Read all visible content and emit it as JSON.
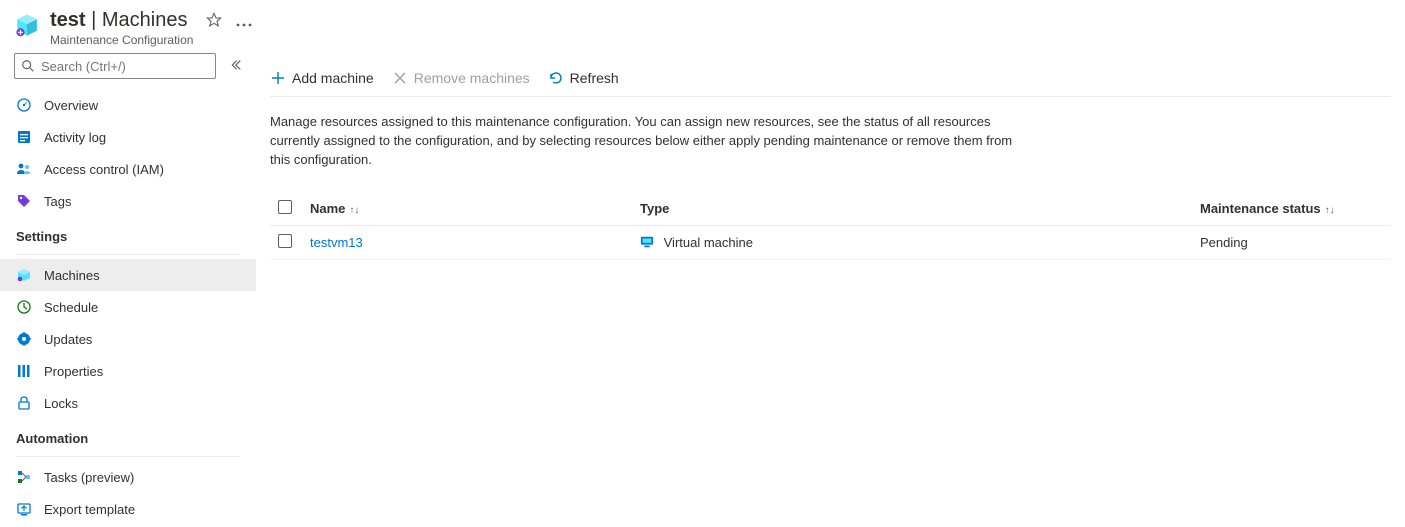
{
  "header": {
    "title_prefix": "test",
    "title_separator": " | ",
    "title_suffix": "Machines",
    "subtitle": "Maintenance Configuration"
  },
  "sidebar": {
    "search_placeholder": "Search (Ctrl+/)",
    "items_top": [
      {
        "label": "Overview"
      },
      {
        "label": "Activity log"
      },
      {
        "label": "Access control (IAM)"
      },
      {
        "label": "Tags"
      }
    ],
    "section_settings": "Settings",
    "items_settings": [
      {
        "label": "Machines"
      },
      {
        "label": "Schedule"
      },
      {
        "label": "Updates"
      },
      {
        "label": "Properties"
      },
      {
        "label": "Locks"
      }
    ],
    "section_automation": "Automation",
    "items_automation": [
      {
        "label": "Tasks (preview)"
      },
      {
        "label": "Export template"
      }
    ]
  },
  "toolbar": {
    "add": "Add machine",
    "remove": "Remove machines",
    "refresh": "Refresh"
  },
  "description": "Manage resources assigned to this maintenance configuration. You can assign new resources, see the status of all resources currently assigned to the configuration, and by selecting resources below either apply pending maintenance or remove them from this configuration.",
  "table": {
    "columns": {
      "name": "Name",
      "type": "Type",
      "status": "Maintenance status"
    },
    "rows": [
      {
        "name": "testvm13",
        "type": "Virtual machine",
        "status": "Pending"
      }
    ]
  }
}
